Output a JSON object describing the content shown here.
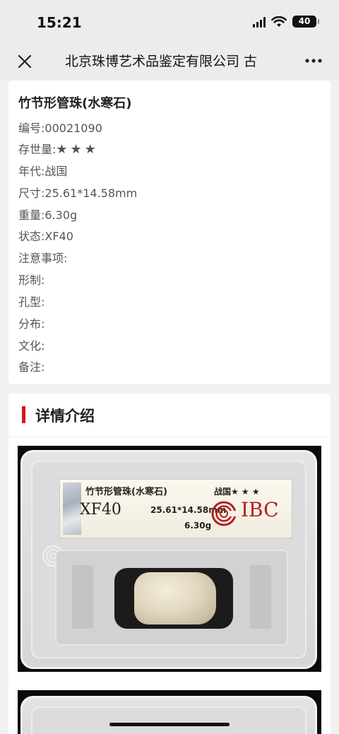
{
  "status_bar": {
    "time": "15:21",
    "battery": "40"
  },
  "nav": {
    "title": "北京珠博艺术品鉴定有限公司 古"
  },
  "item": {
    "title": "竹节形管珠(水寒石)",
    "fields": [
      {
        "label": "编号:",
        "value": "00021090"
      },
      {
        "label": "存世量:",
        "value": "★★★"
      },
      {
        "label": "年代:",
        "value": "战国"
      },
      {
        "label": "尺寸:",
        "value": "25.61*14.58mm"
      },
      {
        "label": "重量:",
        "value": "6.30g"
      },
      {
        "label": "状态:",
        "value": "XF40"
      },
      {
        "label": "注意事项:",
        "value": ""
      },
      {
        "label": "形制:",
        "value": ""
      },
      {
        "label": "孔型:",
        "value": ""
      },
      {
        "label": "分布:",
        "value": ""
      },
      {
        "label": "文化:",
        "value": ""
      },
      {
        "label": "备注:",
        "value": ""
      }
    ]
  },
  "details": {
    "heading": "详情介绍",
    "accent_color": "#d4161c",
    "slab_label": {
      "name": "竹节形管珠(水寒石)",
      "grade": "XF40",
      "size": "25.61*14.58mm",
      "weight": "6.30g",
      "era": "战国★ ★ ★",
      "brand": "IBC"
    }
  }
}
